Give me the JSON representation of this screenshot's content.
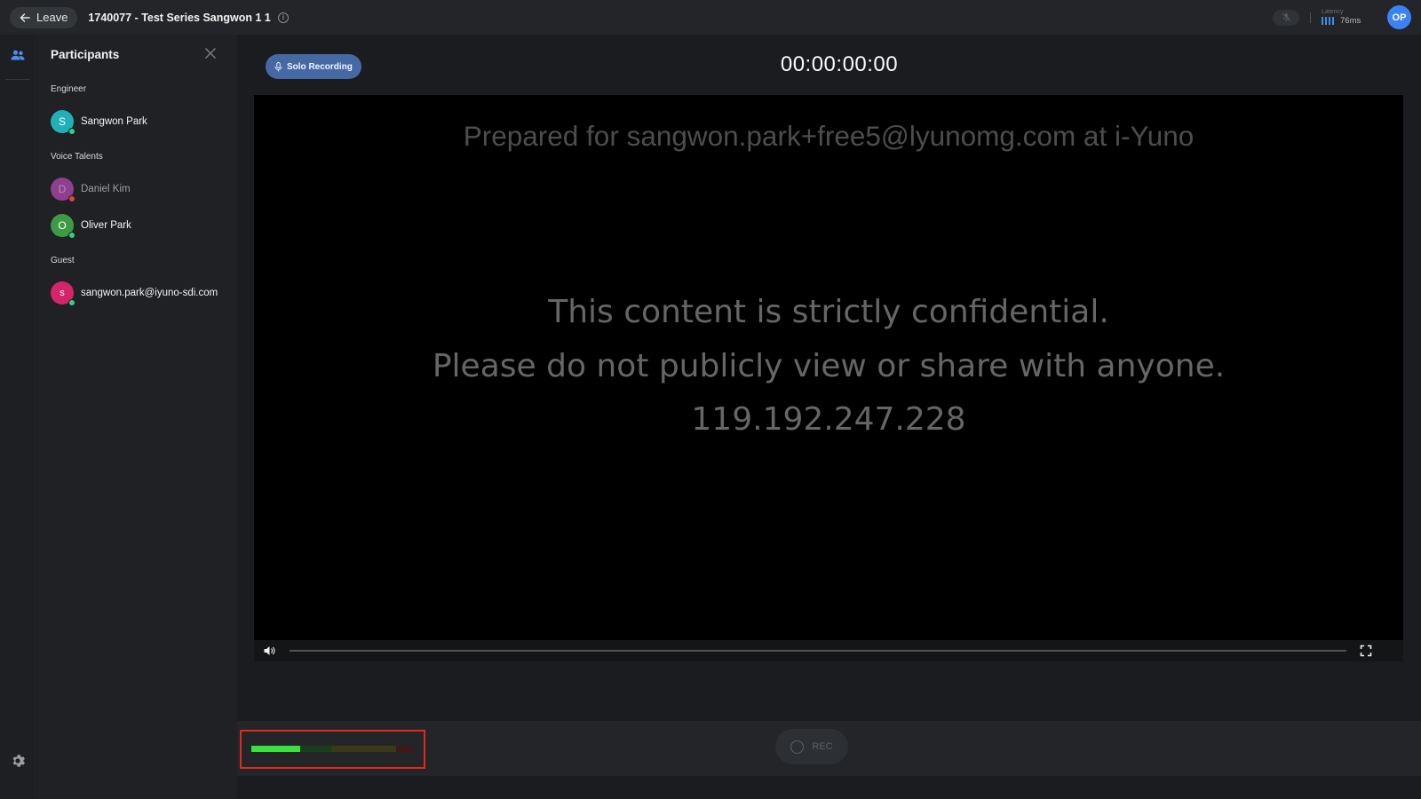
{
  "topbar": {
    "leave_label": "Leave",
    "title": "1740077 - Test Series Sangwon 1 1",
    "latency_label": "Latency",
    "latency_value": "76ms",
    "user_initials": "OP"
  },
  "panel": {
    "title": "Participants",
    "groups": [
      {
        "label": "Engineer",
        "members": [
          {
            "initial": "S",
            "name": "Sangwon Park",
            "avatar_color": "#22b0b8",
            "status_color": "#35d07f",
            "dim": false
          }
        ]
      },
      {
        "label": "Voice Talents",
        "members": [
          {
            "initial": "D",
            "name": "Daniel Kim",
            "avatar_color": "#8e3f8f",
            "status_color": "#e0443e",
            "dim": true
          },
          {
            "initial": "O",
            "name": "Oliver Park",
            "avatar_color": "#3d9a45",
            "status_color": "#35d07f",
            "dim": false
          }
        ]
      },
      {
        "label": "Guest",
        "members": [
          {
            "initial": "s",
            "name": "sangwon.park@iyuno-sdi.com",
            "avatar_color": "#d6246b",
            "status_color": "#35d07f",
            "dim": false
          }
        ]
      }
    ]
  },
  "main": {
    "solo_label": "Solo Recording",
    "timecode": "00:00:00:00",
    "watermark": "Prepared for sangwon.park+free5@lyunomg.com at i-Yuno",
    "confidential": [
      "This content is strictly confidential.",
      "Please do not publicly view or share with anyone.",
      "119.192.247.228"
    ],
    "playback_progress": 0,
    "rec_label": "REC",
    "input_level": 0.3
  },
  "colors": {
    "accent": "#3b82f6",
    "solo_button": "#4669a6",
    "meter_green": "#39e33c",
    "highlight_box": "#e12a1a"
  }
}
